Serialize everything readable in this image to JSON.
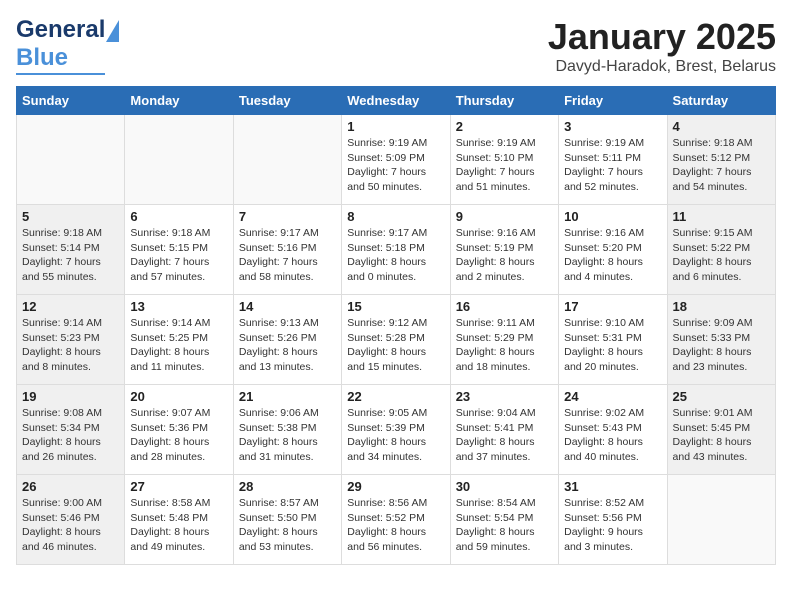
{
  "header": {
    "logo_general": "General",
    "logo_blue": "Blue",
    "title": "January 2025",
    "subtitle": "Davyd-Haradok, Brest, Belarus"
  },
  "days_of_week": [
    "Sunday",
    "Monday",
    "Tuesday",
    "Wednesday",
    "Thursday",
    "Friday",
    "Saturday"
  ],
  "weeks": [
    [
      {
        "day": "",
        "info": "",
        "shade": "empty"
      },
      {
        "day": "",
        "info": "",
        "shade": "empty"
      },
      {
        "day": "",
        "info": "",
        "shade": "empty"
      },
      {
        "day": "1",
        "info": "Sunrise: 9:19 AM\nSunset: 5:09 PM\nDaylight: 7 hours\nand 50 minutes.",
        "shade": ""
      },
      {
        "day": "2",
        "info": "Sunrise: 9:19 AM\nSunset: 5:10 PM\nDaylight: 7 hours\nand 51 minutes.",
        "shade": ""
      },
      {
        "day": "3",
        "info": "Sunrise: 9:19 AM\nSunset: 5:11 PM\nDaylight: 7 hours\nand 52 minutes.",
        "shade": ""
      },
      {
        "day": "4",
        "info": "Sunrise: 9:18 AM\nSunset: 5:12 PM\nDaylight: 7 hours\nand 54 minutes.",
        "shade": "shaded"
      }
    ],
    [
      {
        "day": "5",
        "info": "Sunrise: 9:18 AM\nSunset: 5:14 PM\nDaylight: 7 hours\nand 55 minutes.",
        "shade": "shaded"
      },
      {
        "day": "6",
        "info": "Sunrise: 9:18 AM\nSunset: 5:15 PM\nDaylight: 7 hours\nand 57 minutes.",
        "shade": ""
      },
      {
        "day": "7",
        "info": "Sunrise: 9:17 AM\nSunset: 5:16 PM\nDaylight: 7 hours\nand 58 minutes.",
        "shade": ""
      },
      {
        "day": "8",
        "info": "Sunrise: 9:17 AM\nSunset: 5:18 PM\nDaylight: 8 hours\nand 0 minutes.",
        "shade": ""
      },
      {
        "day": "9",
        "info": "Sunrise: 9:16 AM\nSunset: 5:19 PM\nDaylight: 8 hours\nand 2 minutes.",
        "shade": ""
      },
      {
        "day": "10",
        "info": "Sunrise: 9:16 AM\nSunset: 5:20 PM\nDaylight: 8 hours\nand 4 minutes.",
        "shade": ""
      },
      {
        "day": "11",
        "info": "Sunrise: 9:15 AM\nSunset: 5:22 PM\nDaylight: 8 hours\nand 6 minutes.",
        "shade": "shaded"
      }
    ],
    [
      {
        "day": "12",
        "info": "Sunrise: 9:14 AM\nSunset: 5:23 PM\nDaylight: 8 hours\nand 8 minutes.",
        "shade": "shaded"
      },
      {
        "day": "13",
        "info": "Sunrise: 9:14 AM\nSunset: 5:25 PM\nDaylight: 8 hours\nand 11 minutes.",
        "shade": ""
      },
      {
        "day": "14",
        "info": "Sunrise: 9:13 AM\nSunset: 5:26 PM\nDaylight: 8 hours\nand 13 minutes.",
        "shade": ""
      },
      {
        "day": "15",
        "info": "Sunrise: 9:12 AM\nSunset: 5:28 PM\nDaylight: 8 hours\nand 15 minutes.",
        "shade": ""
      },
      {
        "day": "16",
        "info": "Sunrise: 9:11 AM\nSunset: 5:29 PM\nDaylight: 8 hours\nand 18 minutes.",
        "shade": ""
      },
      {
        "day": "17",
        "info": "Sunrise: 9:10 AM\nSunset: 5:31 PM\nDaylight: 8 hours\nand 20 minutes.",
        "shade": ""
      },
      {
        "day": "18",
        "info": "Sunrise: 9:09 AM\nSunset: 5:33 PM\nDaylight: 8 hours\nand 23 minutes.",
        "shade": "shaded"
      }
    ],
    [
      {
        "day": "19",
        "info": "Sunrise: 9:08 AM\nSunset: 5:34 PM\nDaylight: 8 hours\nand 26 minutes.",
        "shade": "shaded"
      },
      {
        "day": "20",
        "info": "Sunrise: 9:07 AM\nSunset: 5:36 PM\nDaylight: 8 hours\nand 28 minutes.",
        "shade": ""
      },
      {
        "day": "21",
        "info": "Sunrise: 9:06 AM\nSunset: 5:38 PM\nDaylight: 8 hours\nand 31 minutes.",
        "shade": ""
      },
      {
        "day": "22",
        "info": "Sunrise: 9:05 AM\nSunset: 5:39 PM\nDaylight: 8 hours\nand 34 minutes.",
        "shade": ""
      },
      {
        "day": "23",
        "info": "Sunrise: 9:04 AM\nSunset: 5:41 PM\nDaylight: 8 hours\nand 37 minutes.",
        "shade": ""
      },
      {
        "day": "24",
        "info": "Sunrise: 9:02 AM\nSunset: 5:43 PM\nDaylight: 8 hours\nand 40 minutes.",
        "shade": ""
      },
      {
        "day": "25",
        "info": "Sunrise: 9:01 AM\nSunset: 5:45 PM\nDaylight: 8 hours\nand 43 minutes.",
        "shade": "shaded"
      }
    ],
    [
      {
        "day": "26",
        "info": "Sunrise: 9:00 AM\nSunset: 5:46 PM\nDaylight: 8 hours\nand 46 minutes.",
        "shade": "shaded"
      },
      {
        "day": "27",
        "info": "Sunrise: 8:58 AM\nSunset: 5:48 PM\nDaylight: 8 hours\nand 49 minutes.",
        "shade": ""
      },
      {
        "day": "28",
        "info": "Sunrise: 8:57 AM\nSunset: 5:50 PM\nDaylight: 8 hours\nand 53 minutes.",
        "shade": ""
      },
      {
        "day": "29",
        "info": "Sunrise: 8:56 AM\nSunset: 5:52 PM\nDaylight: 8 hours\nand 56 minutes.",
        "shade": ""
      },
      {
        "day": "30",
        "info": "Sunrise: 8:54 AM\nSunset: 5:54 PM\nDaylight: 8 hours\nand 59 minutes.",
        "shade": ""
      },
      {
        "day": "31",
        "info": "Sunrise: 8:52 AM\nSunset: 5:56 PM\nDaylight: 9 hours\nand 3 minutes.",
        "shade": ""
      },
      {
        "day": "",
        "info": "",
        "shade": "empty"
      }
    ]
  ]
}
